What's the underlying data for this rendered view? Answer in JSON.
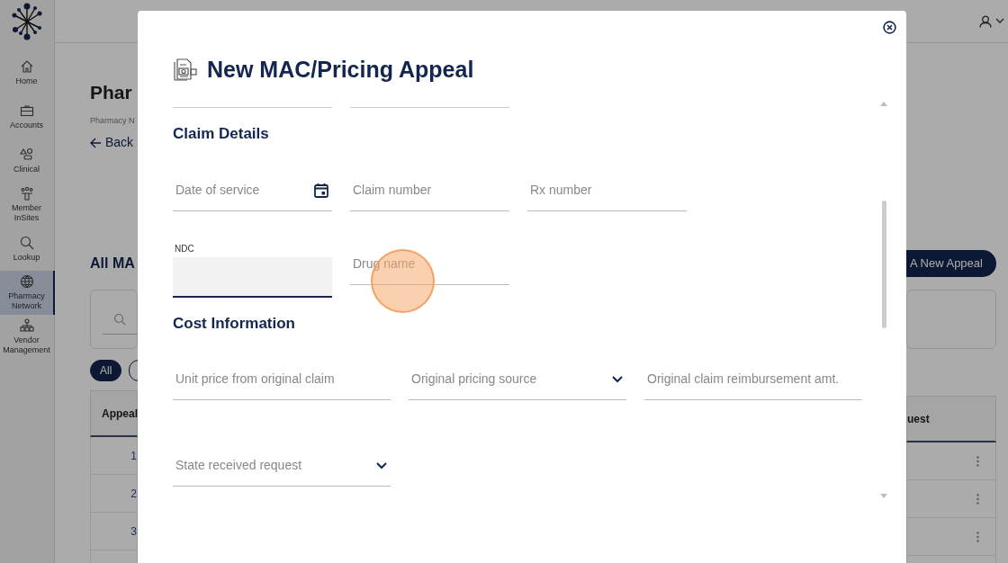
{
  "sidebar": {
    "items": [
      {
        "label": "Home",
        "selected": false
      },
      {
        "label": "Accounts",
        "selected": false
      },
      {
        "label": "Clinical",
        "selected": false
      },
      {
        "label": "Member InSites",
        "selected": false
      },
      {
        "label": "Lookup",
        "selected": false
      },
      {
        "label": "Pharmacy Network",
        "selected": true
      },
      {
        "label": "Vendor Management",
        "selected": false
      }
    ]
  },
  "page": {
    "title": "Phar",
    "breadcrumb": "Pharmacy N",
    "back": "Back",
    "section_title": "All MA",
    "new_appeal_button": "A New Appeal",
    "filters": [
      {
        "label": "All",
        "selected": true
      }
    ],
    "table": {
      "columns": [
        "Appeal",
        "uest"
      ],
      "rows": [
        {
          "column_1": "1"
        },
        {
          "column_1": "2"
        },
        {
          "column_1": "3"
        }
      ]
    }
  },
  "modal": {
    "title": "New MAC/Pricing Appeal",
    "sections": [
      {
        "heading": "Claim Details",
        "rows": [
          [
            {
              "kind": "date",
              "placeholder": "Date of service",
              "focused": false
            },
            {
              "kind": "text",
              "placeholder": "Claim number",
              "focused": false
            },
            {
              "kind": "text",
              "placeholder": "Rx number",
              "focused": false
            }
          ],
          [
            {
              "kind": "text",
              "label": "NDC",
              "focused": true
            },
            {
              "kind": "text",
              "placeholder": "Drug name",
              "focused": false
            }
          ]
        ]
      },
      {
        "heading": "Cost Information",
        "rows": [
          [
            {
              "kind": "text",
              "placeholder": "Unit price from original claim",
              "focused": false
            },
            {
              "kind": "select",
              "placeholder": "Original pricing source",
              "focused": false
            },
            {
              "kind": "text",
              "placeholder": "Original claim reimbursement amt.",
              "focused": false
            }
          ],
          [
            {
              "kind": "select",
              "placeholder": "State received request",
              "focused": false
            }
          ]
        ]
      }
    ]
  }
}
